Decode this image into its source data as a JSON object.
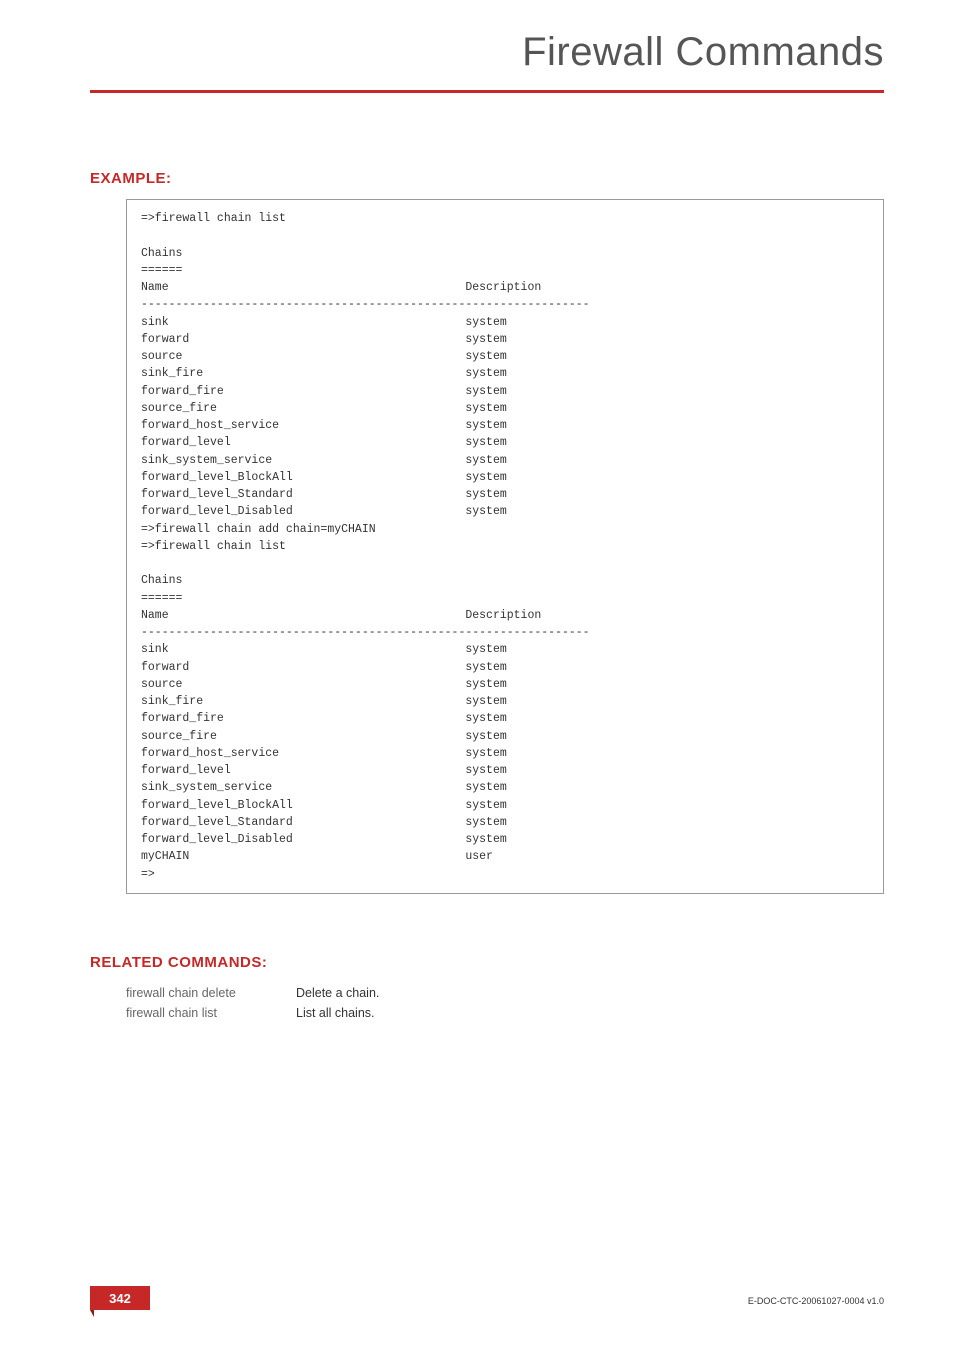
{
  "header": {
    "title": "Firewall Commands"
  },
  "example": {
    "heading": "EXAMPLE:",
    "code": "=>firewall chain list\n\nChains\n======\nName                                           Description\n-----------------------------------------------------------------\nsink                                           system\nforward                                        system\nsource                                         system\nsink_fire                                      system\nforward_fire                                   system\nsource_fire                                    system\nforward_host_service                           system\nforward_level                                  system\nsink_system_service                            system\nforward_level_BlockAll                         system\nforward_level_Standard                         system\nforward_level_Disabled                         system\n=>firewall chain add chain=myCHAIN\n=>firewall chain list\n\nChains\n======\nName                                           Description\n-----------------------------------------------------------------\nsink                                           system\nforward                                        system\nsource                                         system\nsink_fire                                      system\nforward_fire                                   system\nsource_fire                                    system\nforward_host_service                           system\nforward_level                                  system\nsink_system_service                            system\nforward_level_BlockAll                         system\nforward_level_Standard                         system\nforward_level_Disabled                         system\nmyCHAIN                                        user\n=>"
  },
  "related": {
    "heading": "RELATED COMMANDS:",
    "rows": [
      {
        "cmd": "firewall chain delete",
        "desc": "Delete a chain."
      },
      {
        "cmd": "firewall chain list",
        "desc": "List all chains."
      }
    ]
  },
  "footer": {
    "page": "342",
    "docid": "E-DOC-CTC-20061027-0004 v1.0"
  }
}
